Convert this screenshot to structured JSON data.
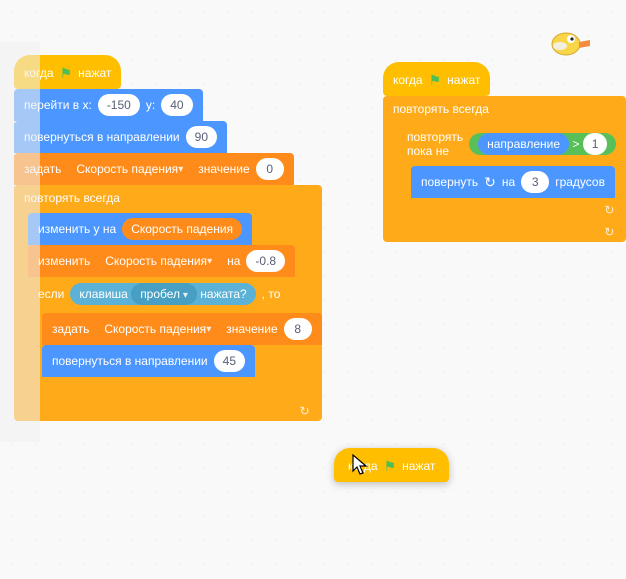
{
  "script1": {
    "when_flag": {
      "prefix": "когда",
      "suffix": "нажат"
    },
    "goto": {
      "label1": "перейти в x:",
      "x": "-150",
      "label2": "y:",
      "y": "40"
    },
    "point_dir": {
      "label": "повернуться в направлении",
      "val": "90"
    },
    "set_var": {
      "label1": "задать",
      "var": "Скорость падения",
      "label2": "значение",
      "val": "0"
    },
    "forever": {
      "label": "повторять всегда"
    },
    "change_y": {
      "label": "изменить y на",
      "var": "Скорость падения"
    },
    "change_var": {
      "label1": "изменить",
      "var": "Скорость падения",
      "label2": "на",
      "val": "-0.8"
    },
    "if_block": {
      "label1": "если",
      "label2": ", то"
    },
    "key_pressed": {
      "label1": "клавиша",
      "key": "пробел",
      "label2": "нажата?"
    },
    "set_var2": {
      "label1": "задать",
      "var": "Скорость падения",
      "label2": "значение",
      "val": "8"
    },
    "point_dir2": {
      "label": "повернуться в направлении",
      "val": "45"
    }
  },
  "script2": {
    "when_flag": {
      "prefix": "когда",
      "suffix": "нажат"
    },
    "forever": {
      "label": "повторять всегда"
    },
    "repeat_until": {
      "label": "повторять пока не"
    },
    "condition": {
      "var": "направление",
      "op": ">",
      "val": "1"
    },
    "turn": {
      "label1": "повернуть",
      "label2": "на",
      "val": "3",
      "label3": "градусов"
    }
  },
  "dragged": {
    "when_flag": {
      "prefix": "когда",
      "suffix": "нажат"
    }
  }
}
